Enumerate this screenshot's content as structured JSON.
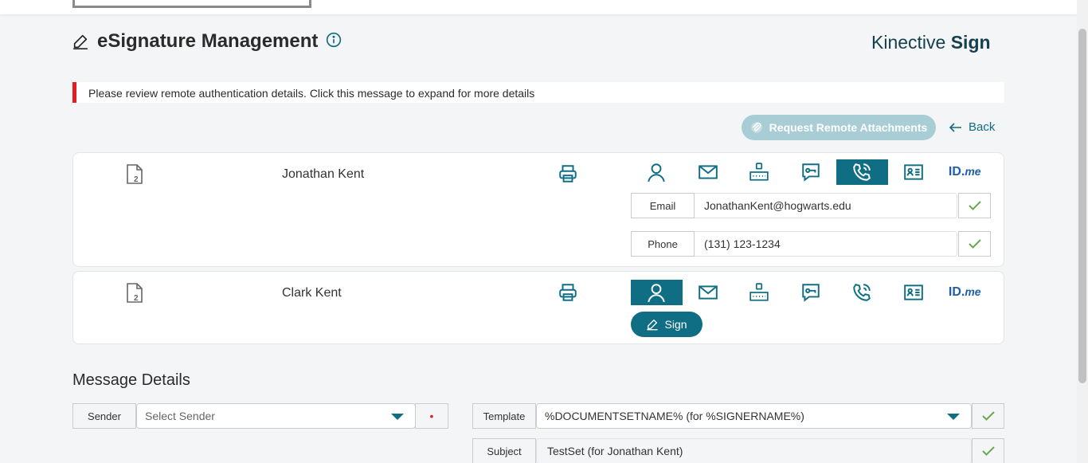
{
  "page": {
    "title": "eSignature Management",
    "brand_prefix": "Kinective ",
    "brand_suffix": "Sign"
  },
  "alert": {
    "message": "Please review remote authentication details. Click this message to expand for more details",
    "color": "#e31b23"
  },
  "actions": {
    "request_attachments": "Request Remote Attachments",
    "back": "Back"
  },
  "auth_methods": [
    "person-icon",
    "email-icon",
    "sms-code-icon",
    "chat-password-icon",
    "phone-icon",
    "id-card-icon",
    "idme-icon"
  ],
  "signers": [
    {
      "name": "Jonathan Kent",
      "active_method": "phone-icon",
      "fields": [
        {
          "label": "Email",
          "value": "JonathanKent@hogwarts.edu"
        },
        {
          "label": "Phone",
          "value": "(131) 123-1234"
        }
      ]
    },
    {
      "name": "Clark Kent",
      "active_method": "person-icon",
      "sign_label": "Sign"
    }
  ],
  "idme": {
    "id": "ID.",
    "me": "me"
  },
  "message_details": {
    "heading": "Message Details",
    "sender_label": "Sender",
    "sender_placeholder": "Select Sender",
    "required_mark": "•",
    "template_label": "Template",
    "template_value": "%DOCUMENTSETNAME% (for %SIGNERNAME%)",
    "subject_label": "Subject",
    "subject_value": "TestSet (for Jonathan Kent)"
  },
  "colors": {
    "accent": "#0f6e84",
    "accent_light": "#a9cdd5",
    "check": "#6aa84f",
    "idme": "#1f5fa7"
  }
}
